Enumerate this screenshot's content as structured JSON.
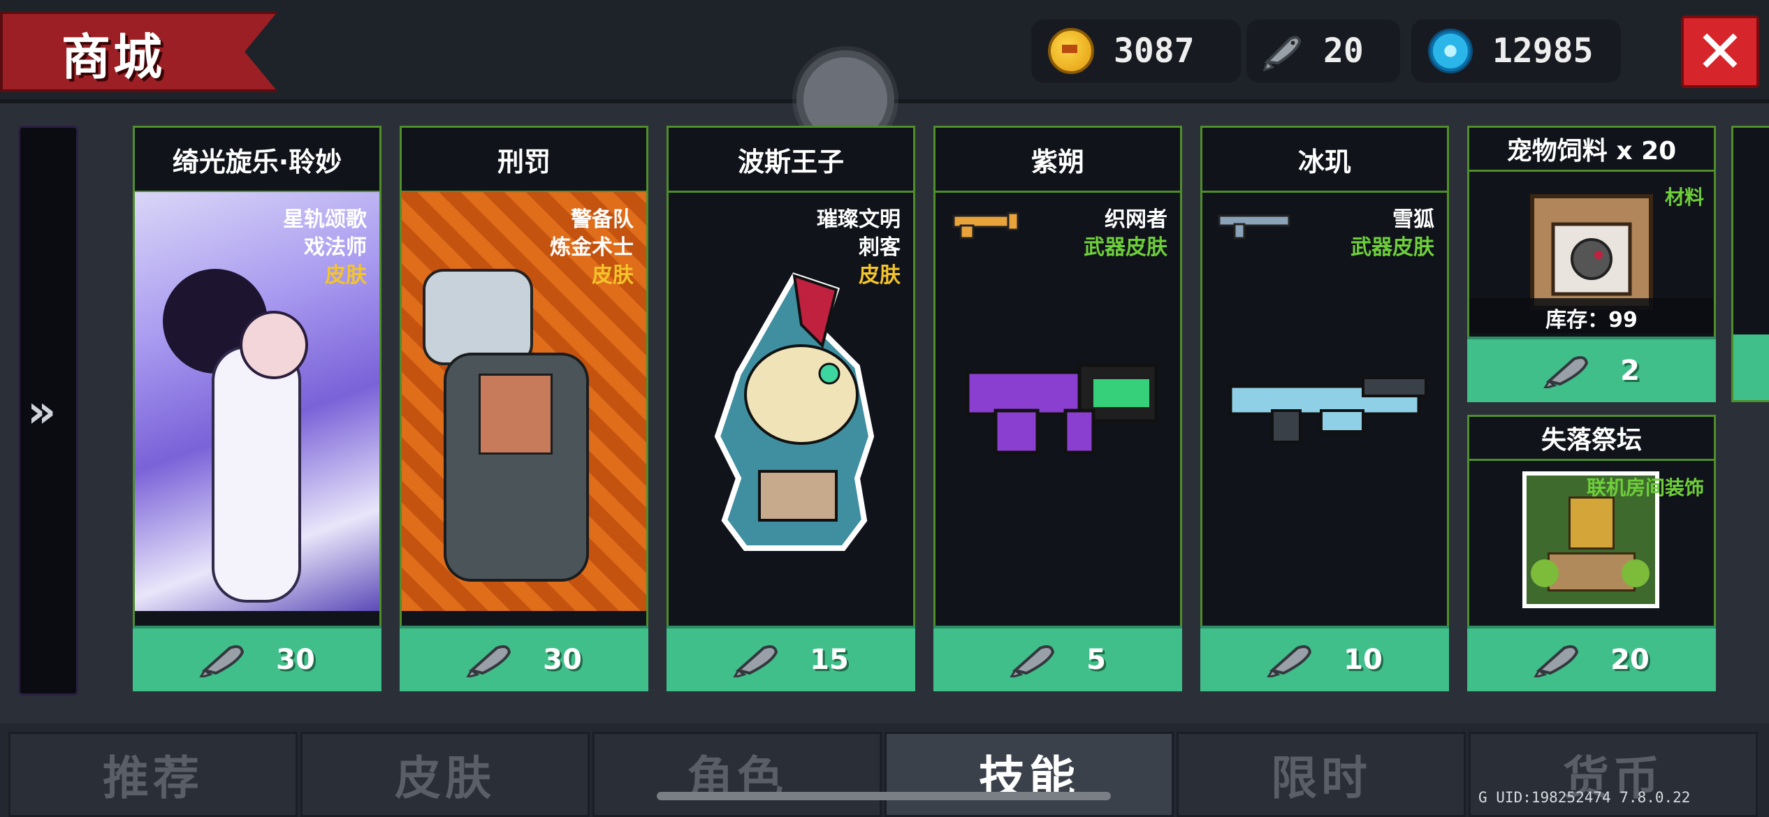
{
  "header": {
    "title": "商城"
  },
  "currencies": [
    {
      "icon": "gold-coin-icon",
      "value": "3087"
    },
    {
      "icon": "fish-icon",
      "value": "20"
    },
    {
      "icon": "blue-gem-icon",
      "value": "12985"
    }
  ],
  "colors": {
    "accent_green": "#41bf8a",
    "card_border": "#4f8f2a",
    "banner_red": "#9b1f24",
    "skin_yellow": "#f4c42b",
    "type_green": "#6ecf3a"
  },
  "cards": [
    {
      "title": "绮光旋乐·聆妙",
      "tags": [
        "星轨颂歌",
        "戏法师"
      ],
      "type": "皮肤",
      "price": "30"
    },
    {
      "title": "刑罚",
      "tags": [
        "警备队",
        "炼金术士"
      ],
      "type": "皮肤",
      "price": "30"
    },
    {
      "title": "波斯王子",
      "tags": [
        "璀璨文明",
        "刺客"
      ],
      "type": "皮肤",
      "price": "15"
    },
    {
      "title": "紫朔",
      "tags": [
        "织网者"
      ],
      "type": "武器皮肤",
      "price": "5"
    },
    {
      "title": "冰玑",
      "tags": [
        "雪狐"
      ],
      "type": "武器皮肤",
      "price": "10"
    }
  ],
  "small_cards": [
    {
      "title": "宠物饲料 x 20",
      "type": "材料",
      "stock": "库存：99",
      "price": "2"
    },
    {
      "title": "失落祭坛",
      "type": "联机房间装饰",
      "price": "20"
    }
  ],
  "tabs": [
    {
      "label": "推荐",
      "active": false
    },
    {
      "label": "皮肤",
      "active": false
    },
    {
      "label": "角色",
      "active": false
    },
    {
      "label": "技能",
      "active": true
    },
    {
      "label": "限时",
      "active": false
    },
    {
      "label": "货币",
      "active": false
    }
  ],
  "footer": {
    "uid": "G UID:198252474 7.8.0.22"
  }
}
